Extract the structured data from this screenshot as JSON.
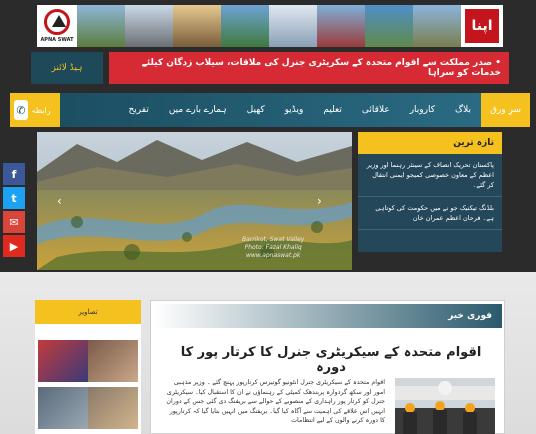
{
  "header": {
    "logo_left_text": "APNA SWAT",
    "logo_right_text": "اپنا"
  },
  "ticker": {
    "button_label": "ہیڈ لائنز",
    "text": "• صدر مملکت سے اقوام متحدہ کے سکریٹری جنرل کی ملاقات، سیلاب زدگان کیلئے خدمات کو سراہا"
  },
  "nav": {
    "call_label": "رابطہ",
    "items": [
      "سرِ ورق",
      "بلاگ",
      "کاروبار",
      "علاقائی",
      "تعلیم",
      "ویڈیو",
      "کھیل",
      "ہمارے بارے میں",
      "تفریح"
    ]
  },
  "social": [
    "f",
    "t",
    "✉",
    "▶"
  ],
  "slider": {
    "caption_line1": "Barrikot, Swat Valley",
    "caption_line2": "Photo: Fazal Khaliq",
    "watermark": "www.apnaswat.pk"
  },
  "latest": {
    "heading": "تازہ ترین",
    "items": [
      "پاکستان تحریک انصاف کے سینئر رہنما اور وزیر اعظم کے معاون خصوصی کمیجو ایمنی انتقال کر گئے۔",
      "بلڈنگ تیکنیک جو نے میں حکومت کی کوتاہی ہے۔ فرحان اعظم عمران خان"
    ]
  },
  "side_widget": {
    "heading": "تصاویر"
  },
  "main_news": {
    "heading": "فوری خبر",
    "title": "اقوام متحدہ کے سیکریٹری جنرل کا کرتار پور کا دورہ",
    "body": "اقوام متحدہ کے سیکریٹری جنرل انٹونیو گوتیرس کرتارپور پہنچ گئے ۔ وزیر مذہبی امور اور سکھ گردوارہ پربندھک کمیٹی کے رہنماؤں نے ان کا استقبال کیا۔ سیکریٹری جنرل کو کرتار پور راہداری کے منصوبے کے حوالے سے بریفنگ دی گئی جس کے دوران انہیں اس علاقے کی اہمیت سے آگاہ کیا گیا۔ بریفنگ میں انہیں بتایا گیا کہ کرتارپور کا دورہ کرنے والوں کے لیے انتظامات"
  },
  "colors": {
    "accent_yellow": "#f4c11f",
    "teal": "#1e4958",
    "ticker_red": "#d62a34"
  }
}
